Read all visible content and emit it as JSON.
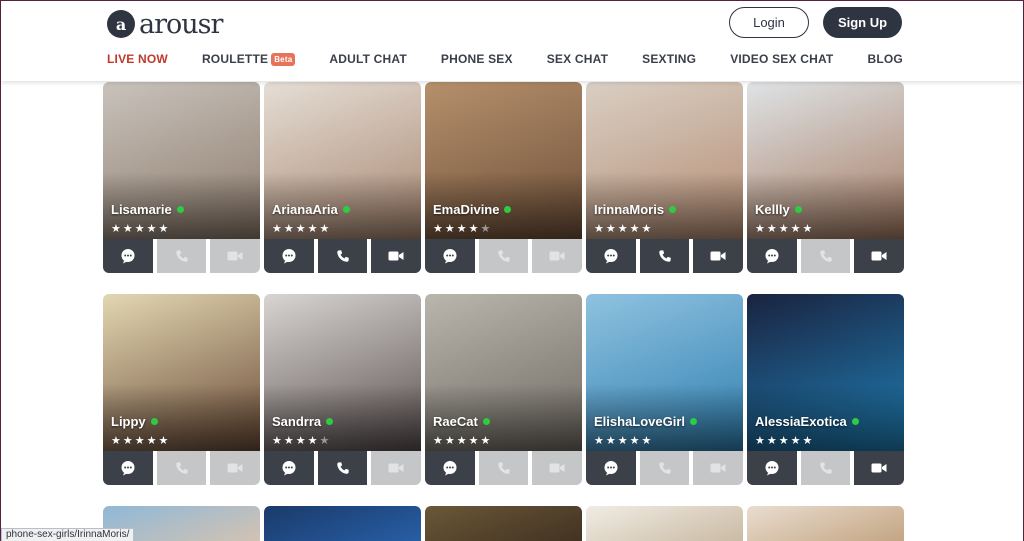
{
  "brand": {
    "logo_mark": "a",
    "logo_text": "arousr"
  },
  "header": {
    "login_label": "Login",
    "signup_label": "Sign Up"
  },
  "nav": [
    {
      "label": "LIVE NOW",
      "active": true
    },
    {
      "label": "ROULETTE",
      "badge": "Beta"
    },
    {
      "label": "ADULT CHAT"
    },
    {
      "label": "PHONE SEX"
    },
    {
      "label": "SEX CHAT"
    },
    {
      "label": "SEXTING"
    },
    {
      "label": "VIDEO SEX CHAT"
    },
    {
      "label": "BLOG"
    }
  ],
  "models": [
    {
      "name": "Lisamarie",
      "rating": 5,
      "phone": false,
      "video": false,
      "colors": [
        "#c9c3bc",
        "#8c7a6b"
      ]
    },
    {
      "name": "ArianaAria",
      "rating": 5,
      "phone": true,
      "video": true,
      "colors": [
        "#e5ded6",
        "#a88670"
      ]
    },
    {
      "name": "EmaDivine",
      "rating": 4,
      "phone": false,
      "video": false,
      "colors": [
        "#b5906c",
        "#6e4f38"
      ]
    },
    {
      "name": "IrinnaMoris",
      "rating": 5,
      "phone": true,
      "video": true,
      "colors": [
        "#d9cfc4",
        "#b58d73"
      ]
    },
    {
      "name": "Kellly",
      "rating": 5,
      "phone": false,
      "video": true,
      "colors": [
        "#dfe3e6",
        "#a57b62"
      ]
    },
    {
      "name": "Lippy",
      "rating": 5,
      "phone": false,
      "video": false,
      "colors": [
        "#e3d7b2",
        "#6a4a36"
      ]
    },
    {
      "name": "Sandrra",
      "rating": 4,
      "phone": true,
      "video": false,
      "colors": [
        "#d8d5d2",
        "#5a5050"
      ]
    },
    {
      "name": "RaeCat",
      "rating": 5,
      "phone": false,
      "video": false,
      "colors": [
        "#b9b6ae",
        "#6f6a62"
      ]
    },
    {
      "name": "ElishaLoveGirl",
      "rating": 5,
      "phone": false,
      "video": false,
      "colors": [
        "#8fc2e0",
        "#2f7fb0"
      ]
    },
    {
      "name": "AlessiaExotica",
      "rating": 5,
      "phone": false,
      "video": true,
      "colors": [
        "#1a2340",
        "#1f7fb5"
      ]
    }
  ],
  "next_row_colors": [
    [
      "#8fb8d8",
      "#d6c3b0"
    ],
    [
      "#1a3a6a",
      "#2860a8"
    ],
    [
      "#6a5838",
      "#403020"
    ],
    [
      "#f0ece4",
      "#c8b8a0"
    ],
    [
      "#e9ddcf",
      "#c2a27f"
    ]
  ],
  "status_url": "phone-sex-girls/IrinnaMoris/"
}
